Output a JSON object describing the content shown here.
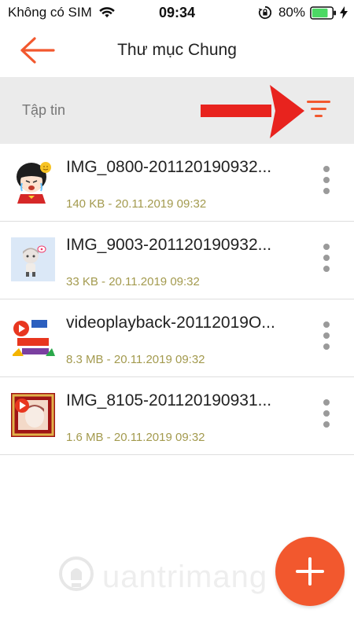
{
  "status_bar": {
    "carrier": "Không có SIM",
    "time": "09:34",
    "battery": "80%",
    "battery_level": 0.8,
    "icons": [
      "wifi-icon",
      "rotation-lock-icon",
      "battery-icon",
      "charging-icon"
    ]
  },
  "header": {
    "title": "Thư mục Chung",
    "back_icon": "arrow-left-icon"
  },
  "section": {
    "label": "Tập tin",
    "filter_icon": "filter-sort-icon"
  },
  "files": [
    {
      "name": "IMG_0800-201120190932...",
      "meta": "140 KB - 20.11.2019 09:32",
      "thumb": "cartoon-girl-thumbnail"
    },
    {
      "name": "IMG_9003-201120190932...",
      "meta": "33 KB - 20.11.2019 09:32",
      "thumb": "chibi-character-thumbnail"
    },
    {
      "name": "videoplayback-20112019O...",
      "meta": "8.3 MB - 20.11.2019 09:32",
      "thumb": "video-songs-thumbnail"
    },
    {
      "name": "IMG_8105-201120190931...",
      "meta": "1.6 MB - 20.11.2019 09:32",
      "thumb": "framed-video-thumbnail"
    }
  ],
  "watermark": "uantrimang",
  "fab_icon": "plus-icon",
  "colors": {
    "accent": "#f2582e",
    "meta_text": "#a39a4e",
    "section_bg": "#ebebeb",
    "annotation_arrow": "#e8231e"
  }
}
